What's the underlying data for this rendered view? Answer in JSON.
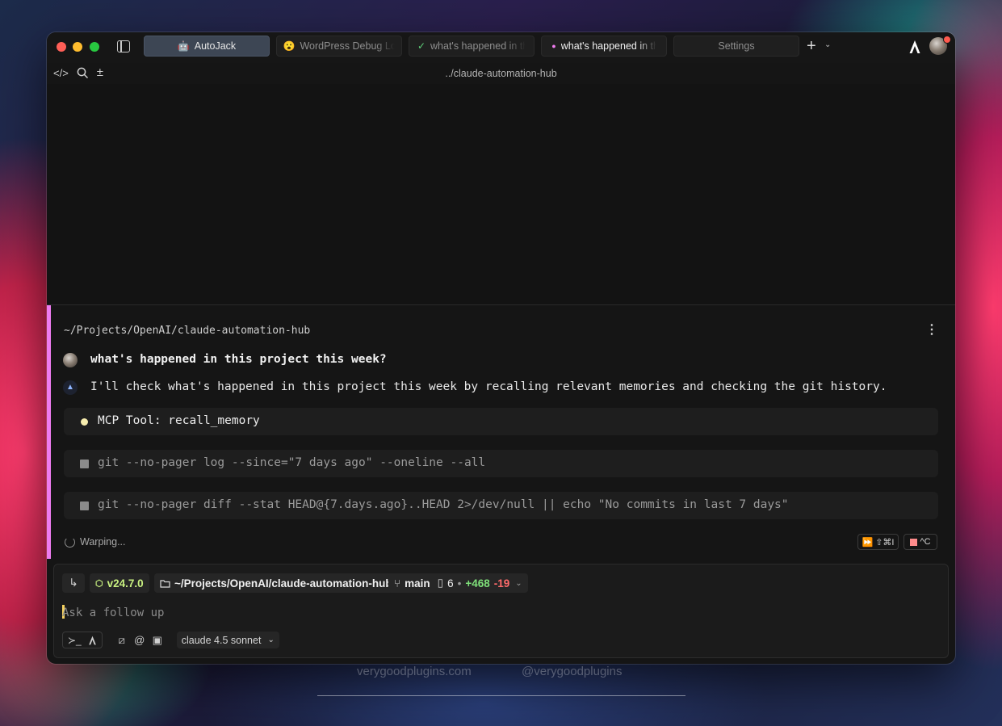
{
  "window": {
    "tabs": [
      {
        "label": "AutoJack",
        "icon": "robot-icon",
        "state": "active"
      },
      {
        "label": "WordPress Debug Log",
        "icon": "emoji-icon",
        "state": "inactive"
      },
      {
        "label": "what's happened in this project this week?",
        "icon": "checkmark-icon",
        "state": "inactive"
      },
      {
        "label": "what's happened in this project this week?",
        "icon": "pink-dot-icon",
        "state": "current"
      },
      {
        "label": "Settings",
        "icon": "",
        "state": "inactive"
      }
    ],
    "path_title": "../claude-automation-hub"
  },
  "block": {
    "cwd": "~/Projects/OpenAI/claude-automation-hub",
    "question": "what's happened in this project this week?",
    "answer": "I'll check what's happened in this project this week by recalling relevant memories and checking the git history.",
    "tools": [
      {
        "label": "MCP Tool: recall_memory",
        "status": "running"
      },
      {
        "label": "git --no-pager log --since=\"7 days ago\" --oneline --all",
        "status": "pending"
      },
      {
        "label": "git --no-pager diff --stat HEAD@{7.days.ago}..HEAD 2>/dev/null || echo \"No commits in last 7 days\"",
        "status": "pending"
      }
    ],
    "status_text": "Warping...",
    "shortcut_continue": "⇧⌘I",
    "shortcut_stop": "^C"
  },
  "input": {
    "node_version": "v24.7.0",
    "cwd": "~/Projects/OpenAI/claude-automation-hub",
    "branch": "main",
    "files_changed": "6",
    "separator": "•",
    "additions": "+468",
    "deletions": "-19",
    "placeholder": "Ask a follow up",
    "model": "claude 4.5 sonnet"
  },
  "watermark": {
    "site": "verygoodplugins.com",
    "handle": "@verygoodplugins"
  },
  "colors": {
    "accent_bar": "#ee7cf0",
    "active_tab": "#3d4654",
    "caret": "#f4d160",
    "additions": "#7fe07a",
    "deletions": "#ff6b6b"
  }
}
